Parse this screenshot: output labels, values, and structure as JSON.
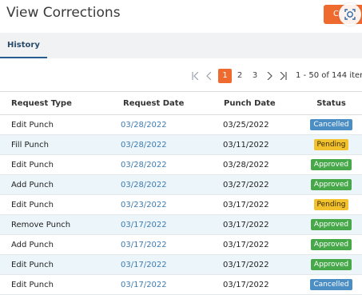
{
  "header": {
    "title": "View Corrections",
    "close_label": "Close"
  },
  "tabs": [
    {
      "label": "History",
      "active": true
    }
  ],
  "pagination": {
    "pages": [
      "1",
      "2",
      "3"
    ],
    "current": "1",
    "range_text": "1 - 50 of 144 items"
  },
  "table": {
    "columns": [
      "Request Type",
      "Request Date",
      "Punch Date",
      "Status"
    ],
    "rows": [
      {
        "type": "Edit Punch",
        "request_date": "03/28/2022",
        "punch_date": "03/25/2022",
        "status": "Cancelled"
      },
      {
        "type": "Fill Punch",
        "request_date": "03/28/2022",
        "punch_date": "03/11/2022",
        "status": "Pending"
      },
      {
        "type": "Edit Punch",
        "request_date": "03/28/2022",
        "punch_date": "03/28/2022",
        "status": "Approved"
      },
      {
        "type": "Add Punch",
        "request_date": "03/28/2022",
        "punch_date": "03/27/2022",
        "status": "Approved"
      },
      {
        "type": "Edit Punch",
        "request_date": "03/23/2022",
        "punch_date": "03/17/2022",
        "status": "Pending"
      },
      {
        "type": "Remove Punch",
        "request_date": "03/17/2022",
        "punch_date": "03/17/2022",
        "status": "Approved"
      },
      {
        "type": "Add Punch",
        "request_date": "03/17/2022",
        "punch_date": "03/17/2022",
        "status": "Approved"
      },
      {
        "type": "Edit Punch",
        "request_date": "03/17/2022",
        "punch_date": "03/17/2022",
        "status": "Approved"
      },
      {
        "type": "Edit Punch",
        "request_date": "03/17/2022",
        "punch_date": "03/17/2022",
        "status": "Cancelled"
      }
    ]
  },
  "colors": {
    "accent": "#ef6a2e",
    "link": "#3d7bb0",
    "row_alt": "#ebf5fa",
    "cancelled": "#4b8ec4",
    "approved": "#47a84a",
    "pending": "#f2c12e"
  },
  "icons": {
    "first_page": "first-page-icon",
    "prev_page": "prev-page-icon",
    "next_page": "next-page-icon",
    "last_page": "last-page-icon",
    "capture": "screen-capture-icon"
  }
}
